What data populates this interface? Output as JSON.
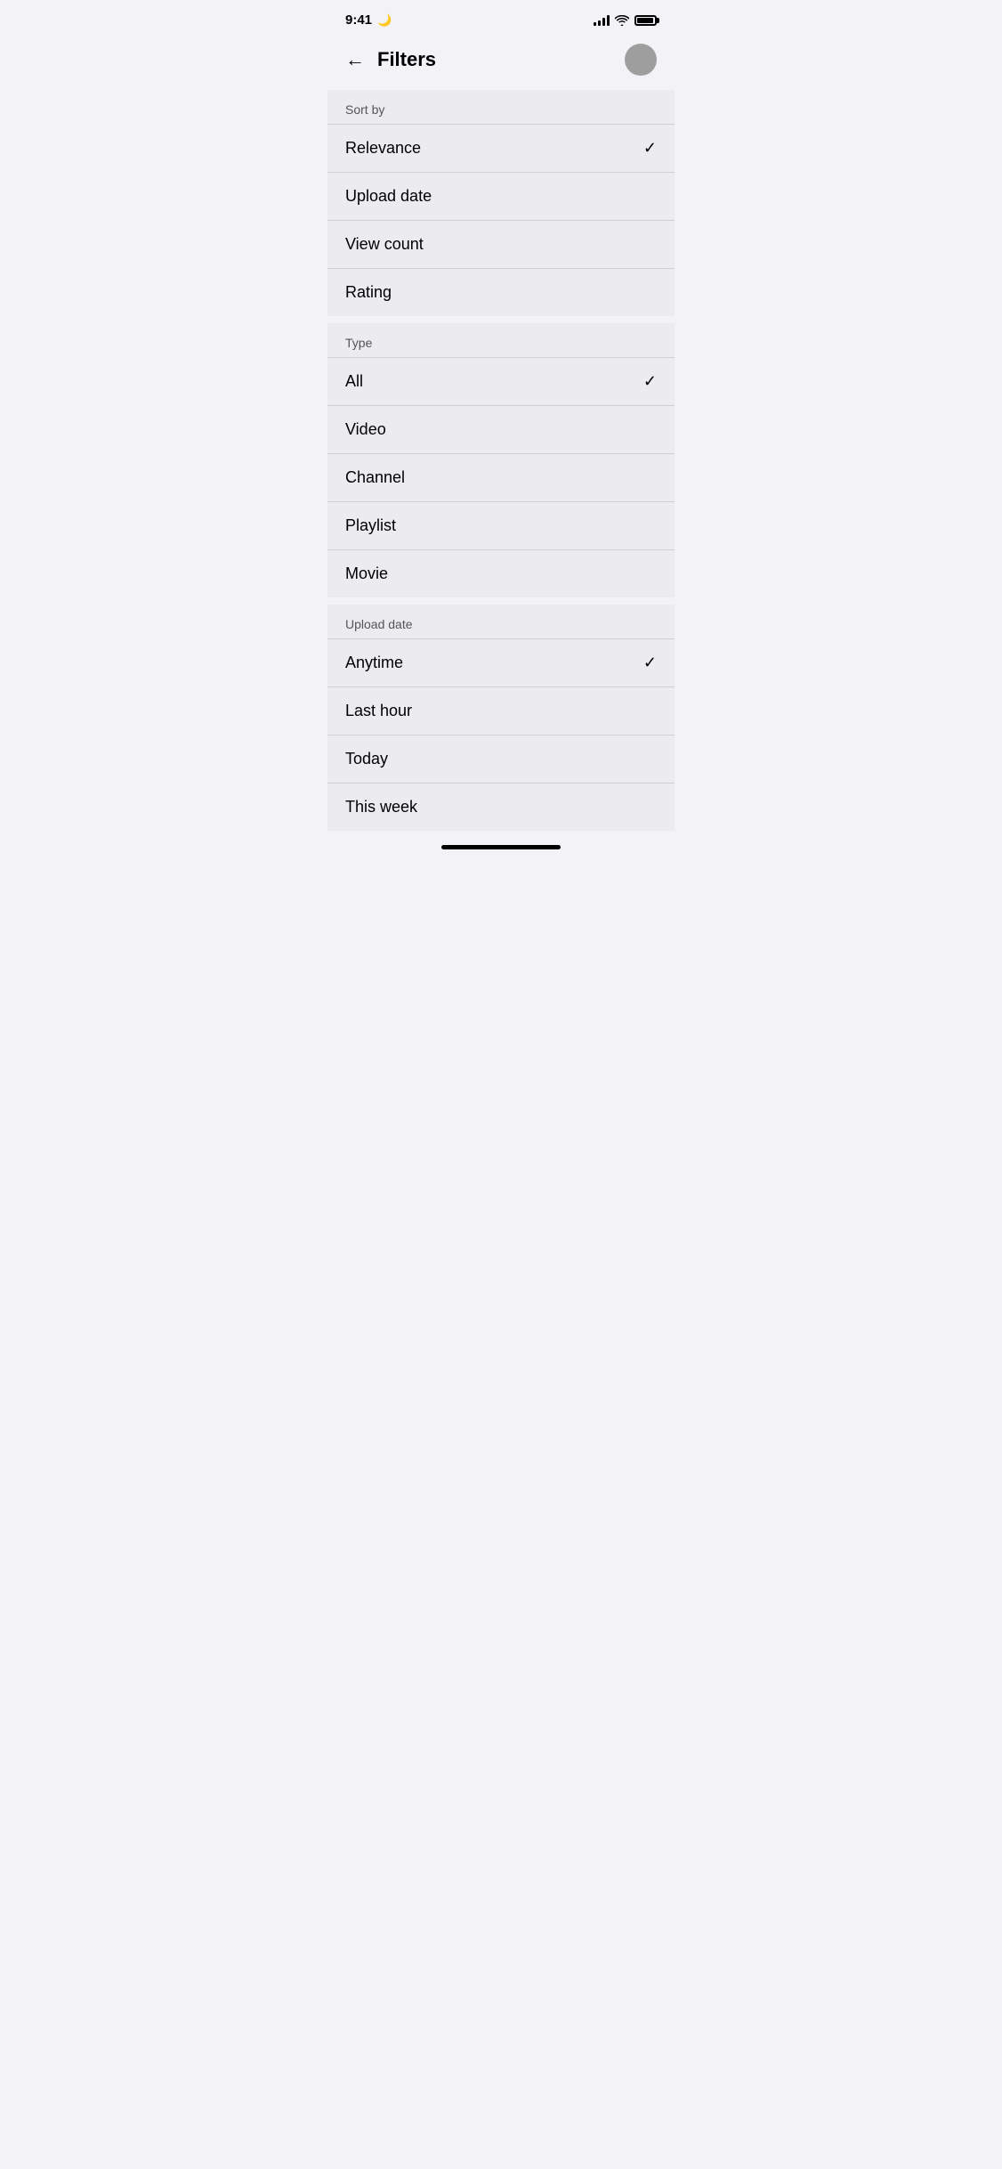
{
  "statusBar": {
    "time": "9:41",
    "moonIcon": "🌙"
  },
  "header": {
    "title": "Filters",
    "backLabel": "←"
  },
  "sections": [
    {
      "id": "sort-by",
      "header": "Sort by",
      "items": [
        {
          "label": "Relevance",
          "checked": true
        },
        {
          "label": "Upload date",
          "checked": false
        },
        {
          "label": "View count",
          "checked": false
        },
        {
          "label": "Rating",
          "checked": false
        }
      ]
    },
    {
      "id": "type",
      "header": "Type",
      "items": [
        {
          "label": "All",
          "checked": true
        },
        {
          "label": "Video",
          "checked": false
        },
        {
          "label": "Channel",
          "checked": false
        },
        {
          "label": "Playlist",
          "checked": false
        },
        {
          "label": "Movie",
          "checked": false
        }
      ]
    },
    {
      "id": "upload-date",
      "header": "Upload date",
      "items": [
        {
          "label": "Anytime",
          "checked": true
        },
        {
          "label": "Last hour",
          "checked": false
        },
        {
          "label": "Today",
          "checked": false
        },
        {
          "label": "This week",
          "checked": false
        }
      ]
    }
  ]
}
